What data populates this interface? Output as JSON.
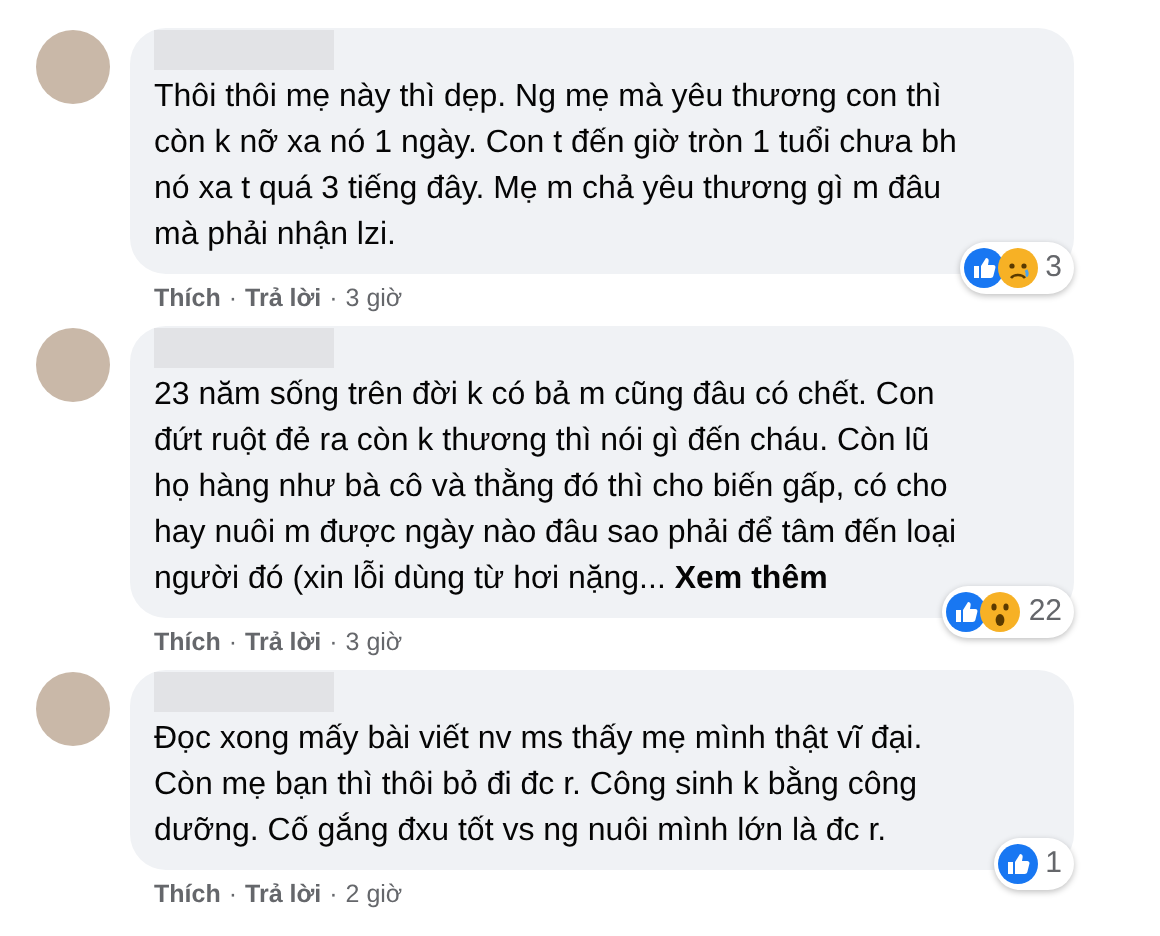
{
  "comments": [
    {
      "name_blurred": true,
      "lines": [
        "Thôi thôi mẹ này thì dẹp. Ng mẹ mà yêu thương con thì",
        "còn k nỡ xa nó 1 ngày. Con t đến giờ tròn 1 tuổi chưa bh",
        "nó xa t quá 3 tiếng đây. Mẹ m chả yêu thương gì m đâu",
        "mà phải nhận lzi."
      ],
      "reactions": [
        {
          "kind": "like"
        },
        {
          "kind": "sad"
        }
      ],
      "reaction_count": "3",
      "actions": {
        "like": "Thích",
        "separator": "·",
        "reply": "Trả lời",
        "time": "3 giờ"
      }
    },
    {
      "name_blurred": true,
      "lines": [
        "23 năm sống trên đời k có bả m cũng đâu có chết. Con",
        "đứt ruột đẻ ra còn k thương thì nói gì đến cháu. Còn lũ",
        "họ hàng như bà cô và thằng đó thì cho biến gấp, có cho",
        "hay nuôi m được ngày nào đâu sao phải để tâm đến loại",
        "người đó (xin lỗi dùng từ hơi nặng..."
      ],
      "see_more": "Xem thêm",
      "reactions": [
        {
          "kind": "like"
        },
        {
          "kind": "wow"
        }
      ],
      "reaction_count": "22",
      "actions": {
        "like": "Thích",
        "separator": "·",
        "reply": "Trả lời",
        "time": "3 giờ"
      }
    },
    {
      "name_blurred": true,
      "lines": [
        "Đọc xong mấy bài viết nv ms thấy mẹ mình thật vĩ đại.",
        "Còn mẹ bạn thì thôi bỏ đi đc r. Công sinh k bằng công",
        "dưỡng. Cố gắng đxu tốt vs ng nuôi mình lớn là đc r."
      ],
      "reactions": [
        {
          "kind": "like"
        }
      ],
      "reaction_count": "1",
      "actions": {
        "like": "Thích",
        "separator": "·",
        "reply": "Trả lời",
        "time": "2 giờ"
      }
    }
  ]
}
